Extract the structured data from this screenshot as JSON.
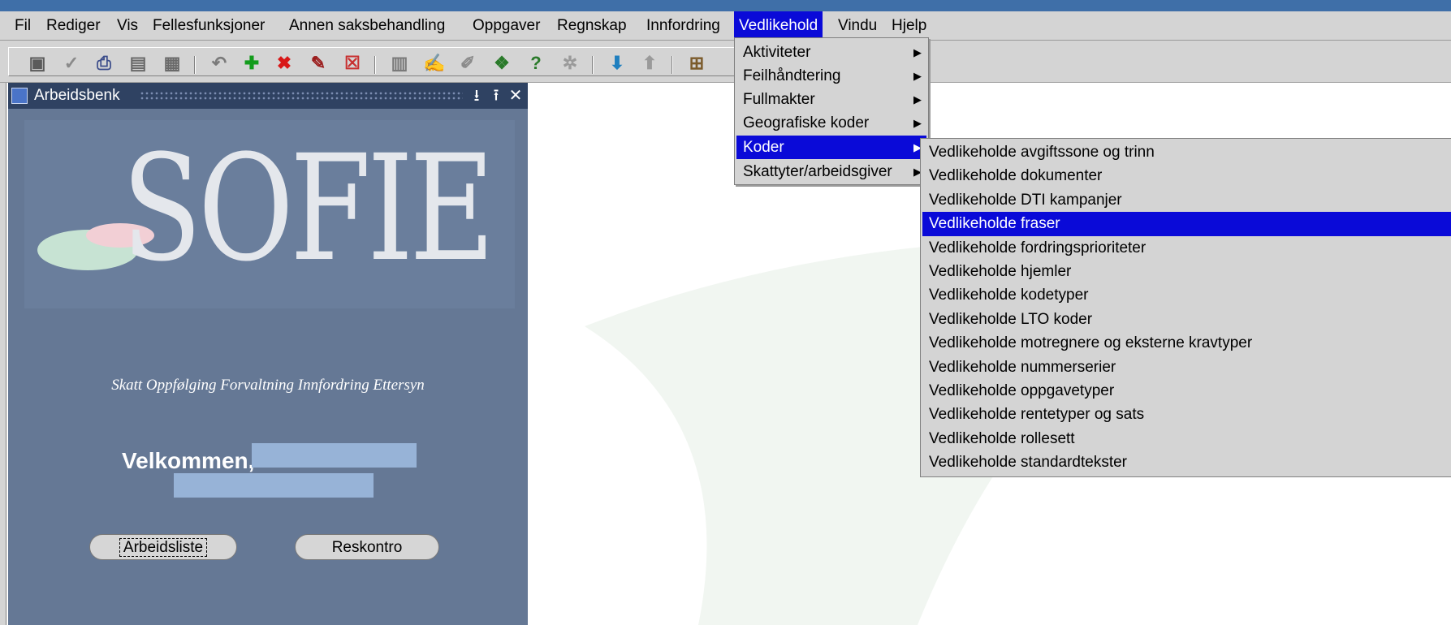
{
  "menubar": {
    "items": [
      {
        "label": "Fil"
      },
      {
        "label": "Rediger"
      },
      {
        "label": "Vis"
      },
      {
        "label": "Fellesfunksjoner"
      },
      {
        "label": "Annen saksbehandling"
      },
      {
        "label": "Oppgaver"
      },
      {
        "label": "Regnskap"
      },
      {
        "label": "Innfordring"
      },
      {
        "label": "Vedlikehold"
      },
      {
        "label": "Vindu"
      },
      {
        "label": "Hjelp"
      }
    ]
  },
  "arbeidsbenk": {
    "title": "Arbeidsbenk",
    "logo_text": "SOFIE",
    "tagline": "Skatt Oppfølging Forvaltning Innfordring Ettersyn",
    "welcome": "Velkommen,",
    "buttons": {
      "arbeidsliste": "Arbeidsliste",
      "reskontro": "Reskontro"
    }
  },
  "vedlikehold_menu": {
    "items": [
      {
        "label": "Aktiviteter"
      },
      {
        "label": "Feilhåndtering"
      },
      {
        "label": "Fullmakter"
      },
      {
        "label": "Geografiske koder"
      },
      {
        "label": "Koder"
      },
      {
        "label": "Skattyter/arbeidsgiver"
      }
    ]
  },
  "koder_submenu": {
    "items": [
      {
        "label": "Vedlikeholde avgiftssone og trinn"
      },
      {
        "label": "Vedlikeholde dokumenter"
      },
      {
        "label": "Vedlikeholde DTI kampanjer"
      },
      {
        "label": "Vedlikeholde fraser"
      },
      {
        "label": "Vedlikeholde fordringsprioriteter"
      },
      {
        "label": "Vedlikeholde hjemler"
      },
      {
        "label": "Vedlikeholde kodetyper"
      },
      {
        "label": "Vedlikeholde LTO koder"
      },
      {
        "label": "Vedlikeholde motregnere og eksterne kravtyper"
      },
      {
        "label": "Vedlikeholde nummerserier"
      },
      {
        "label": "Vedlikeholde oppgavetyper"
      },
      {
        "label": "Vedlikeholde rentetyper og sats"
      },
      {
        "label": "Vedlikeholde rollesett"
      },
      {
        "label": "Vedlikeholde standardtekster"
      }
    ]
  },
  "colors": {
    "highlight": "#0a0ad8",
    "panel": "#657895",
    "titlebar": "#2f4262"
  }
}
